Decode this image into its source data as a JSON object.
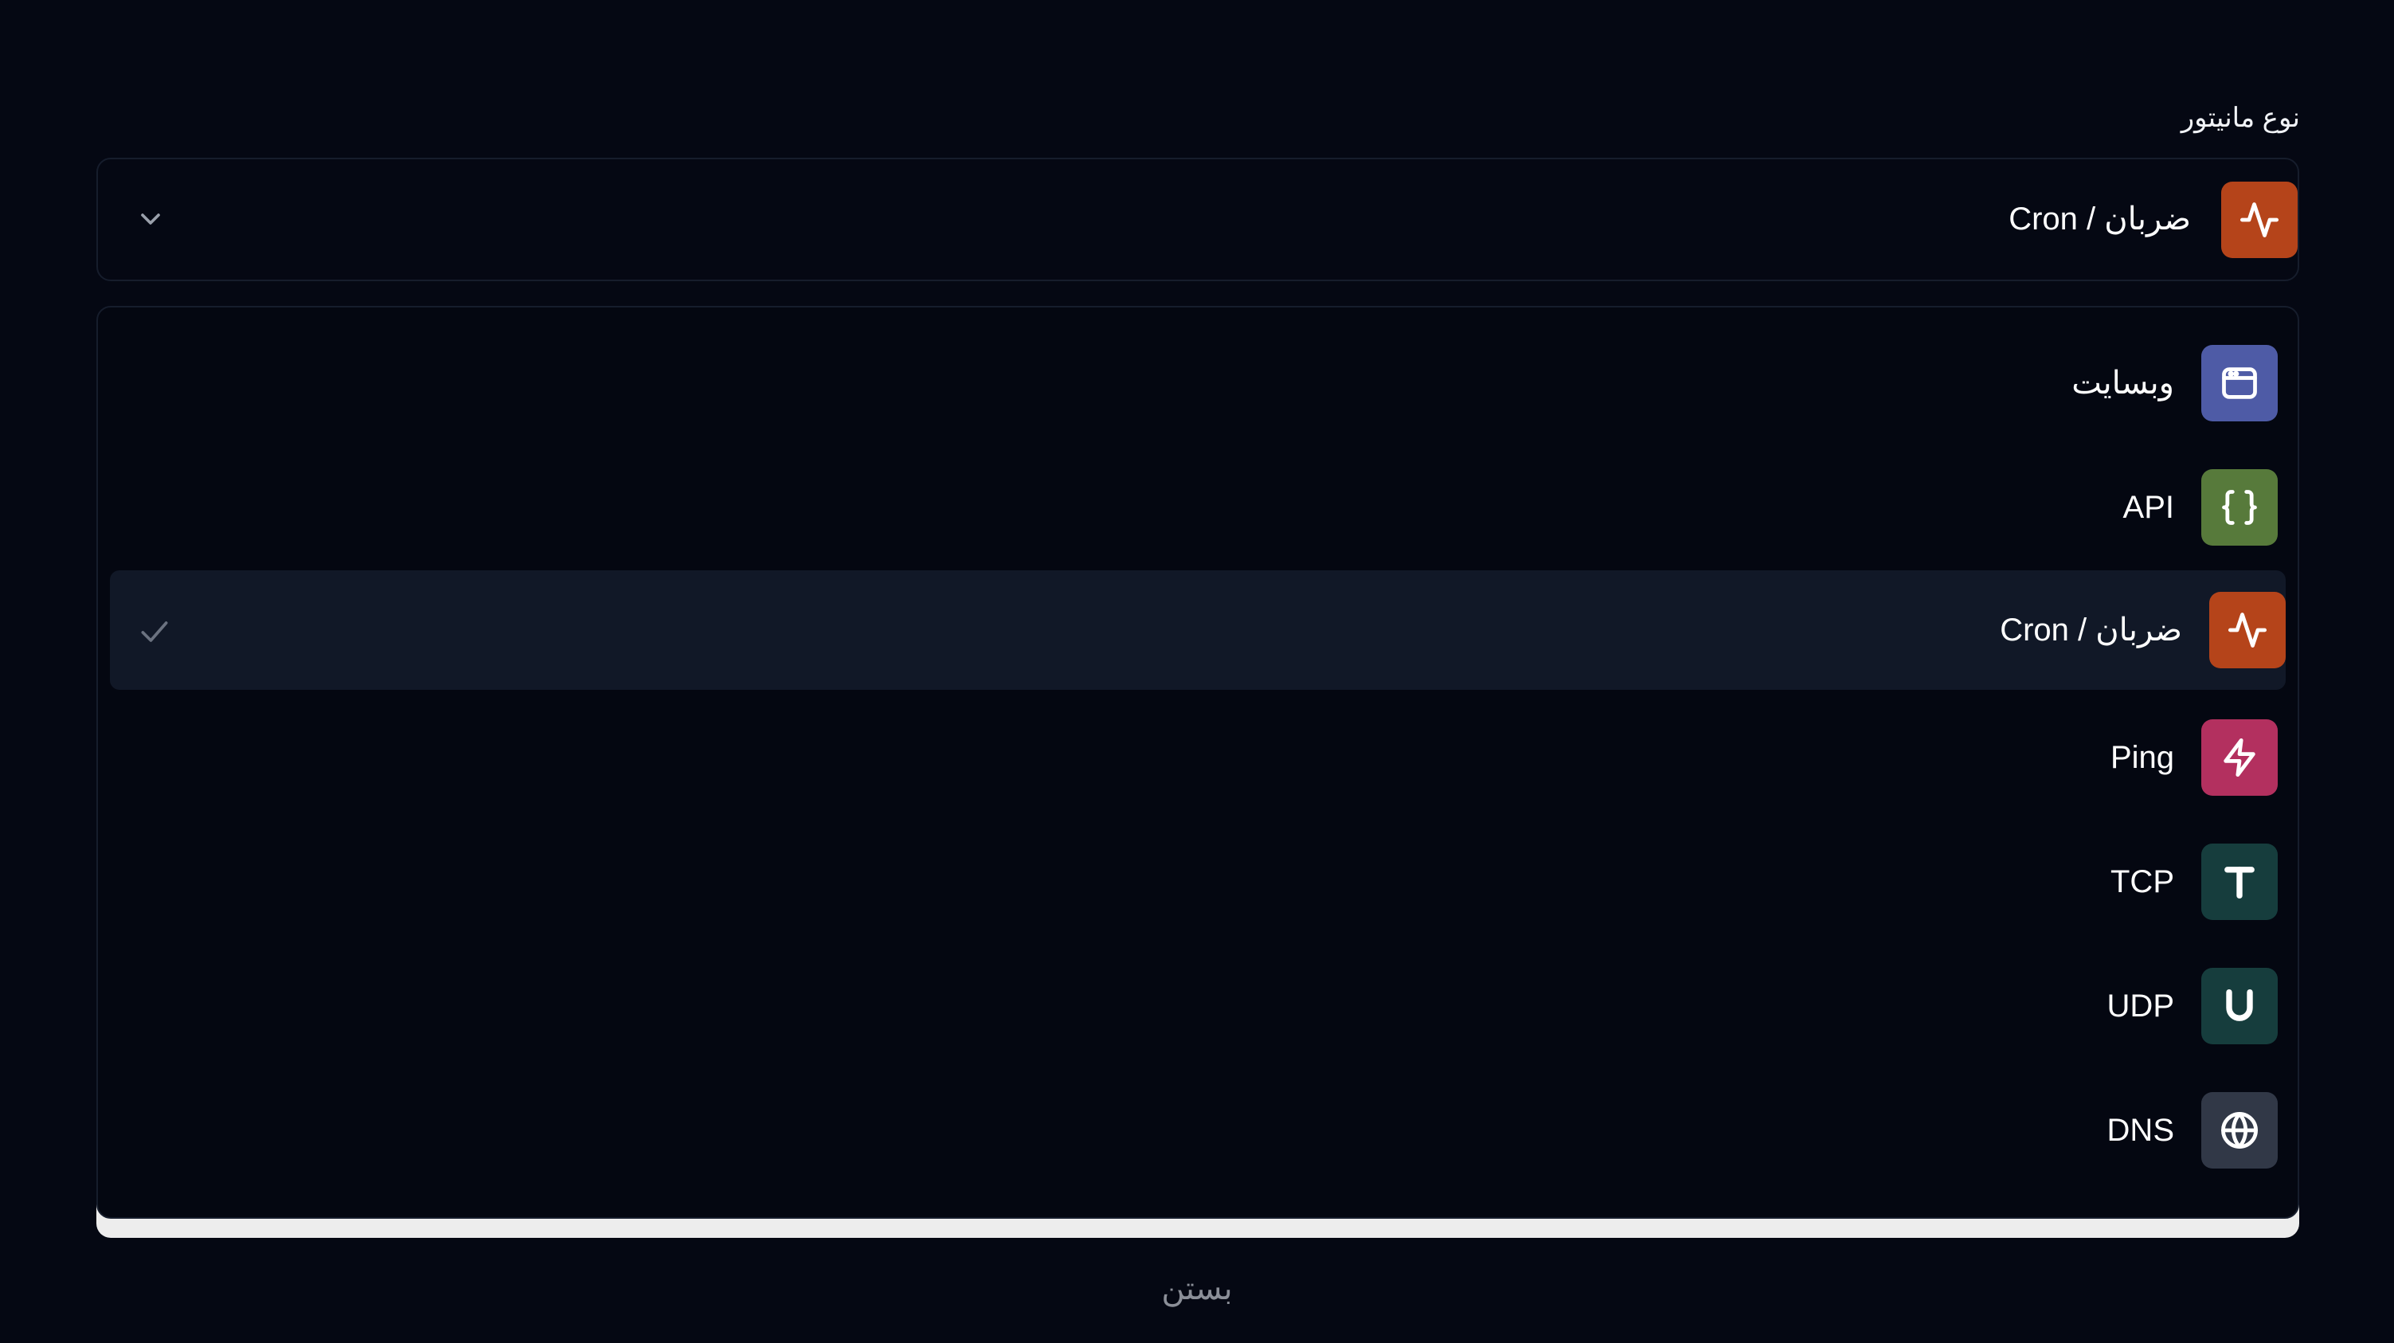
{
  "field": {
    "label": "نوع مانیتور"
  },
  "trigger": {
    "selected_label": "ضربان / Cron",
    "icon": "activity-icon",
    "color": "#b5441a"
  },
  "options": [
    {
      "label": "وبسایت",
      "icon": "browser-window-icon",
      "color": "#4e5ba6",
      "selected": false
    },
    {
      "label": "API",
      "icon": "braces-icon",
      "color": "#577a3b",
      "selected": false
    },
    {
      "label": "ضربان / Cron",
      "icon": "activity-icon",
      "color": "#b5441a",
      "selected": true
    },
    {
      "label": "Ping",
      "icon": "zap-icon",
      "color": "#b3305f",
      "selected": false
    },
    {
      "label": "TCP",
      "icon": "letter-t-icon",
      "color": "#163d3d",
      "selected": false
    },
    {
      "label": "UDP",
      "icon": "letter-u-icon",
      "color": "#163d3d",
      "selected": false
    },
    {
      "label": "DNS",
      "icon": "globe-icon",
      "color": "#313847",
      "selected": false
    }
  ],
  "footer": {
    "close_label": "بستن"
  },
  "colors": {
    "background": "#050813",
    "selected_row": "#111827",
    "border": "#161d2c"
  }
}
